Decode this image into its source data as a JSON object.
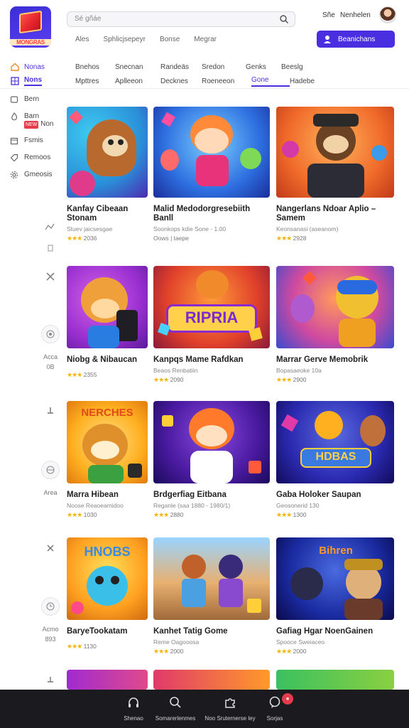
{
  "header": {
    "logo_text": "MONGRAS",
    "search_placeholder": "Sé gñáe",
    "top_links": [
      "Ales",
      "Sphlicjsepeyr",
      "Bonse",
      "Megrar"
    ],
    "user_short": "Sñe",
    "user_name": "Nenhelen",
    "cta_label": "Beanichans"
  },
  "side_top": [
    {
      "label": "Nonas",
      "icon": "home-icon"
    },
    {
      "label": "Nons",
      "icon": "grid-icon"
    }
  ],
  "categories": {
    "row1": [
      "Bnehos",
      "Snecnan",
      "Randeäs",
      "Sredon",
      "Genks",
      "Beeslg"
    ],
    "row2": [
      "Mpttres",
      "Aplleeon",
      "Decknes",
      "Roeneeon",
      "Gone",
      "Hadebe"
    ],
    "active": "Gone"
  },
  "sidebar": [
    {
      "label": "Bern",
      "icon": "cube-icon",
      "badge": ""
    },
    {
      "label": "Barn",
      "label2": "Non",
      "icon": "fire-icon",
      "badge": "NEW"
    },
    {
      "label": "Fsmis",
      "icon": "calendar-icon",
      "badge": ""
    },
    {
      "label": "Remoos",
      "icon": "tag-icon",
      "badge": ""
    },
    {
      "label": "Gmeosis",
      "icon": "gear-icon",
      "badge": ""
    }
  ],
  "gutter": {
    "row1_label": "",
    "row2_label": "Acca",
    "row2_sub": "0B",
    "row3_label": "Area",
    "row4_label": "Acmo",
    "row4_sub": "893"
  },
  "games": [
    {
      "title": "Kanfay Cibeaan Stonam",
      "sub": "Stuev jaicsesgae",
      "rating": "2036"
    },
    {
      "title": "Malid Medodorgresebiith Banll",
      "sub": "Soonkops kdie Sone - 1.00",
      "sub2": "Oows | taepe",
      "rating": ""
    },
    {
      "title": "Nangerlans Ndoar Aplio – Samem",
      "sub": "Keonsanasi (aseanom)",
      "rating": "2928"
    },
    {
      "title": "Niobg & Nibaucan",
      "sub": "",
      "rating": "2355"
    },
    {
      "title": "Kanpqs Mame Rafdkan",
      "sub": "Beaos Renbatiin",
      "rating": "2090"
    },
    {
      "title": "Marrar Gerve Memobrik",
      "sub": "Bopasaeoke 10a",
      "rating": "2900"
    },
    {
      "title": "Marra Hibean",
      "sub": "Noose Reaoeamidoo",
      "rating": "1030"
    },
    {
      "title": "Brdgerfiag Eitbana",
      "sub": "Reganle (saa 1880 - 1980/1)",
      "rating": "2880"
    },
    {
      "title": "Gaba Holoker Saupan",
      "sub": "Geosonerid 130",
      "rating": "1300"
    },
    {
      "title": "BaryeTookatam",
      "sub": "",
      "rating": "1130"
    },
    {
      "title": "Kanhet Tatig Gome",
      "sub": "Reme Oagooosa",
      "rating": "2000"
    },
    {
      "title": "Gafiag Hgar NoenGainen",
      "sub": "Spooce Sweiaceo",
      "rating": "2000"
    }
  ],
  "thumb_texts": {
    "g5": "RIPRIA",
    "g7": "NERCHES",
    "g9": "HDBAS",
    "g10": "HNOBS",
    "g12": "Bihren"
  },
  "bottom_tabs": [
    {
      "label": "Shenao",
      "icon": "headphones-icon"
    },
    {
      "label": "Somarerlenmes",
      "icon": "search-icon"
    },
    {
      "label": "Noo Sruternerse ley",
      "icon": "puzzle-icon"
    },
    {
      "label": "Sorjas",
      "icon": "chat-icon"
    }
  ],
  "notif_count": "●",
  "colors": {
    "accent": "#4a2fe0",
    "star": "#f4b400",
    "bottom_bar": "#1b1b1f"
  }
}
